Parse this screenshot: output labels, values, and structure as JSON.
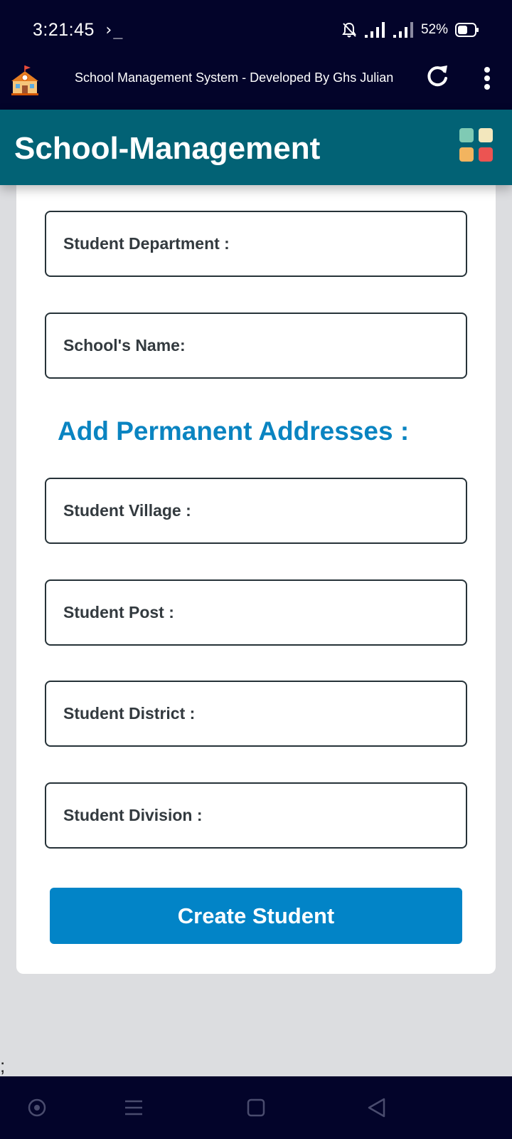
{
  "status_bar": {
    "time": "3:21:45",
    "terminal_glyph": "›_",
    "battery": "52%",
    "icons": [
      "bell-muted-icon",
      "signal-icon",
      "signal-icon",
      "battery-icon"
    ]
  },
  "app_bar": {
    "title": "School Management System - Developed By Ghs Julian",
    "icons": [
      "school-logo-icon",
      "refresh-icon",
      "more-vert-icon"
    ]
  },
  "header": {
    "title": "School-Management",
    "grid_colors": [
      "#7fcab4",
      "#f3e7bd",
      "#f2b45f",
      "#ec5452"
    ]
  },
  "form": {
    "fields": [
      {
        "label": "Student Department :"
      },
      {
        "label": "School's Name:"
      }
    ],
    "address_heading": "Add Permanent Addresses :",
    "address_fields": [
      {
        "label": "Student Village :"
      },
      {
        "label": "Student Post :"
      },
      {
        "label": "Student District :"
      },
      {
        "label": "Student Division :"
      }
    ],
    "submit_label": "Create Student"
  },
  "stray_text": ";",
  "nav_bar": {
    "icons": [
      "assistant-icon",
      "menu-icon",
      "home-square-icon",
      "back-triangle-icon"
    ]
  },
  "colors": {
    "system_bar": "#03042a",
    "header": "#026275",
    "accent": "#0284c7",
    "heading": "#0a84c1"
  }
}
